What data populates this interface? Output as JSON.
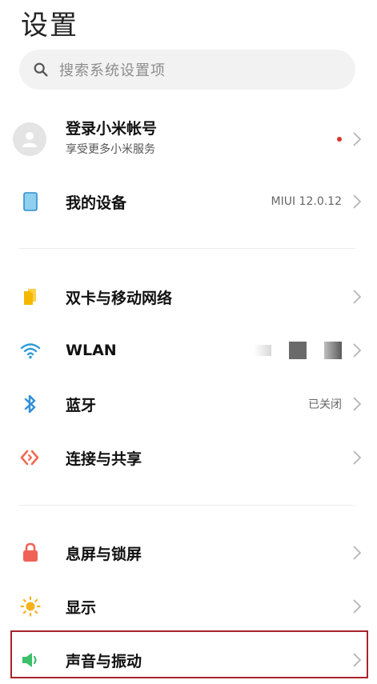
{
  "page": {
    "title": "设置"
  },
  "search": {
    "placeholder": "搜索系统设置项"
  },
  "account": {
    "title": "登录小米帐号",
    "subtitle": "享受更多小米服务"
  },
  "device": {
    "label": "我的设备",
    "value": "MIUI 12.0.12"
  },
  "items": [
    {
      "label": "双卡与移动网络",
      "value": ""
    },
    {
      "label": "WLAN",
      "value": ""
    },
    {
      "label": "蓝牙",
      "value": "已关闭"
    },
    {
      "label": "连接与共享",
      "value": ""
    },
    {
      "label": "息屏与锁屏",
      "value": ""
    },
    {
      "label": "显示",
      "value": ""
    },
    {
      "label": "声音与振动",
      "value": ""
    }
  ],
  "colors": {
    "accent_highlight": "#a8232a",
    "sim_icon": "#f5b800",
    "wifi_icon": "#2f9bd8",
    "bluetooth_icon": "#2f8fd8",
    "share_icon": "#f06a4f",
    "lock_icon": "#f06257",
    "display_icon": "#f6b21b",
    "sound_icon": "#3bbf6a",
    "device_icon": "#8fd0ef"
  }
}
